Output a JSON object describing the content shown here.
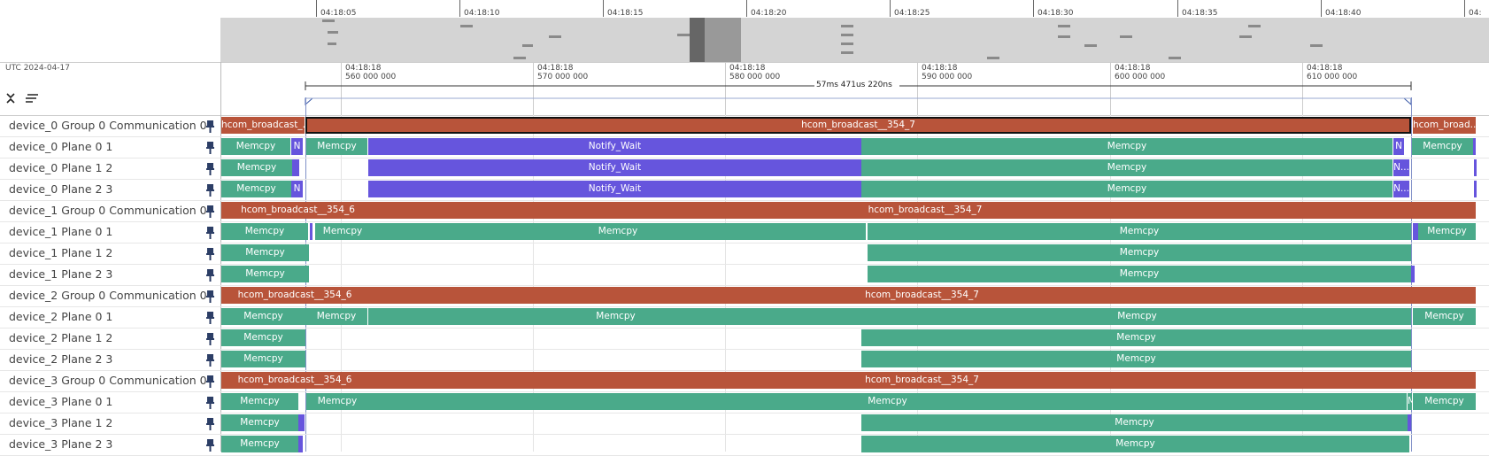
{
  "overview": {
    "ticks": [
      "04:18:05",
      "04:18:10",
      "04:18:15",
      "04:18:20",
      "04:18:25",
      "04:18:30",
      "04:18:35",
      "04:18:40",
      "04:"
    ]
  },
  "ruler": {
    "timezone_label": "UTC 2024-04-17",
    "ticks": [
      {
        "time": "04:18:18",
        "ns": "560 000 000"
      },
      {
        "time": "04:18:18",
        "ns": "570 000 000"
      },
      {
        "time": "04:18:18",
        "ns": "580 000 000"
      },
      {
        "time": "04:18:18",
        "ns": "590 000 000"
      },
      {
        "time": "04:18:18",
        "ns": "600 000 000"
      },
      {
        "time": "04:18:18",
        "ns": "610 000 000"
      }
    ],
    "selection_duration": "57ms 471us 220ns"
  },
  "tracks": [
    {
      "label": "device_0 Group 0 Communication 0",
      "slices": [
        {
          "t": "hcom_broadcast_...",
          "c": "hcom"
        },
        {
          "t": "hcom_broadcast__354_7",
          "c": "hcom",
          "sel": true
        },
        {
          "t": "hcom_broad...",
          "c": "hcom"
        }
      ]
    },
    {
      "label": "device_0 Plane 0 1",
      "slices": [
        {
          "t": "Memcpy",
          "c": "memcpy"
        },
        {
          "t": "N",
          "c": "notify"
        },
        {
          "t": "Memcpy",
          "c": "memcpy"
        },
        {
          "t": "Notify_Wait",
          "c": "notify"
        },
        {
          "t": "Memcpy",
          "c": "memcpy"
        },
        {
          "t": "N",
          "c": "notify"
        },
        {
          "t": "Memcpy",
          "c": "memcpy"
        },
        {
          "t": "",
          "c": "notify"
        }
      ]
    },
    {
      "label": "device_0 Plane 1 2",
      "slices": [
        {
          "t": "Memcpy",
          "c": "memcpy"
        },
        {
          "t": "",
          "c": "notify"
        },
        {
          "t": "Notify_Wait",
          "c": "notify"
        },
        {
          "t": "Memcpy",
          "c": "memcpy"
        },
        {
          "t": "N...",
          "c": "notify"
        },
        {
          "t": "",
          "c": "notify"
        }
      ]
    },
    {
      "label": "device_0 Plane 2 3",
      "slices": [
        {
          "t": "Memcpy",
          "c": "memcpy"
        },
        {
          "t": "N",
          "c": "notify"
        },
        {
          "t": "Notify_Wait",
          "c": "notify"
        },
        {
          "t": "Memcpy",
          "c": "memcpy"
        },
        {
          "t": "N...",
          "c": "notify"
        },
        {
          "t": "",
          "c": "notify"
        }
      ]
    },
    {
      "label": "device_1 Group 0 Communication 0",
      "slices": [
        {
          "t": "hcom_broadcast__354_6",
          "c": "hcom"
        },
        {
          "t": "hcom_broadcast__354_7",
          "c": "hcom"
        }
      ]
    },
    {
      "label": "device_1 Plane 0 1",
      "slices": [
        {
          "t": "Memcpy",
          "c": "memcpy"
        },
        {
          "t": "",
          "c": "notify"
        },
        {
          "t": "Memcpy",
          "c": "memcpy"
        },
        {
          "t": "Memcpy",
          "c": "memcpy"
        },
        {
          "t": "Memcpy",
          "c": "memcpy"
        },
        {
          "t": "",
          "c": "notify"
        },
        {
          "t": "Memcpy",
          "c": "memcpy"
        }
      ]
    },
    {
      "label": "device_1 Plane 1 2",
      "slices": [
        {
          "t": "Memcpy",
          "c": "memcpy"
        },
        {
          "t": "Memcpy",
          "c": "memcpy"
        }
      ]
    },
    {
      "label": "device_1 Plane 2 3",
      "slices": [
        {
          "t": "Memcpy",
          "c": "memcpy"
        },
        {
          "t": "Memcpy",
          "c": "memcpy"
        },
        {
          "t": "",
          "c": "notify"
        }
      ]
    },
    {
      "label": "device_2 Group 0 Communication 0",
      "slices": [
        {
          "t": "hcom_broadcast__354_6",
          "c": "hcom"
        },
        {
          "t": "hcom_broadcast__354_7",
          "c": "hcom"
        }
      ]
    },
    {
      "label": "device_2 Plane 0 1",
      "slices": [
        {
          "t": "Memcpy",
          "c": "memcpy"
        },
        {
          "t": "Memcpy",
          "c": "memcpy"
        },
        {
          "t": "Memcpy",
          "c": "memcpy"
        },
        {
          "t": "Memcpy",
          "c": "memcpy"
        },
        {
          "t": "Memcpy",
          "c": "memcpy"
        }
      ]
    },
    {
      "label": "device_2 Plane 1 2",
      "slices": [
        {
          "t": "Memcpy",
          "c": "memcpy"
        },
        {
          "t": "Memcpy",
          "c": "memcpy"
        }
      ]
    },
    {
      "label": "device_2 Plane 2 3",
      "slices": [
        {
          "t": "Memcpy",
          "c": "memcpy"
        },
        {
          "t": "Memcpy",
          "c": "memcpy"
        }
      ]
    },
    {
      "label": "device_3 Group 0 Communication 0",
      "slices": [
        {
          "t": "hcom_broadcast__354_6",
          "c": "hcom"
        },
        {
          "t": "hcom_broadcast__354_7",
          "c": "hcom"
        }
      ]
    },
    {
      "label": "device_3 Plane 0 1",
      "slices": [
        {
          "t": "Memcpy",
          "c": "memcpy"
        },
        {
          "t": "Memcpy",
          "c": "memcpy"
        },
        {
          "t": "Memcpy",
          "c": "memcpy"
        },
        {
          "t": "Memcpy",
          "c": "memcpy"
        },
        {
          "t": "Memcpy",
          "c": "memcpy"
        }
      ]
    },
    {
      "label": "device_3 Plane 1 2",
      "slices": [
        {
          "t": "Memcpy",
          "c": "memcpy"
        },
        {
          "t": "",
          "c": "notify"
        },
        {
          "t": "Memcpy",
          "c": "memcpy"
        },
        {
          "t": "",
          "c": "notify"
        }
      ]
    },
    {
      "label": "device_3 Plane 2 3",
      "slices": [
        {
          "t": "Memcpy",
          "c": "memcpy"
        },
        {
          "t": "",
          "c": "notify"
        },
        {
          "t": "Memcpy",
          "c": "memcpy"
        }
      ]
    }
  ],
  "colors": {
    "memcpy": "#4aaa8a",
    "notify": "#6655dd",
    "hcom": "#b8543a"
  },
  "icons": {
    "collapse": "collapse-all-icon",
    "filter": "filter-lines-icon",
    "pin": "pin-icon"
  }
}
